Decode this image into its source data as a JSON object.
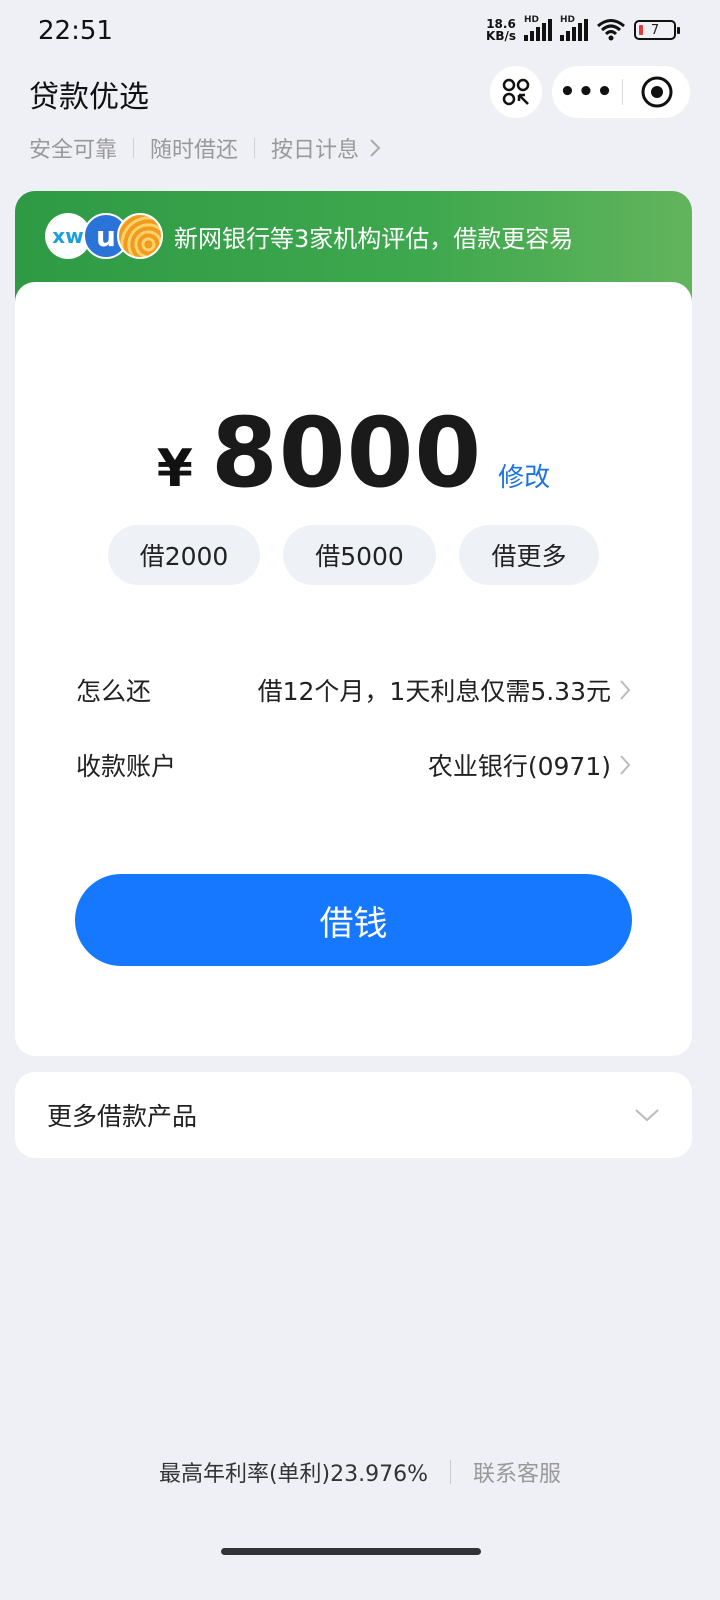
{
  "status_bar": {
    "time": "22:51",
    "net_speed_value": "18.6",
    "net_speed_unit": "KB/s",
    "sim1_label": "HD",
    "sim2_label": "HD",
    "battery": "7"
  },
  "header": {
    "title": "贷款优选",
    "more_label": "•••"
  },
  "tags": [
    "安全可靠",
    "随时借还",
    "按日计息"
  ],
  "banner": {
    "logo_text_1": "xw",
    "logo_text_2": "u",
    "text": "新网银行等3家机构评估，借款更容易"
  },
  "loan": {
    "currency": "¥",
    "amount": "8000",
    "edit_label": "修改",
    "chips": [
      "借2000",
      "借5000",
      "借更多"
    ]
  },
  "repay": {
    "label": "怎么还",
    "value": "借12个月，1天利息仅需5.33元"
  },
  "account": {
    "label": "收款账户",
    "value": "农业银行(0971)"
  },
  "borrow_button": "借钱",
  "more_products": "更多借款产品",
  "footer": {
    "rate": "最高年利率(单利)23.976%",
    "service": "联系客服"
  },
  "colors": {
    "primary": "#1677ff",
    "banner_green": "#3ea84e",
    "background": "#eef0f5"
  }
}
